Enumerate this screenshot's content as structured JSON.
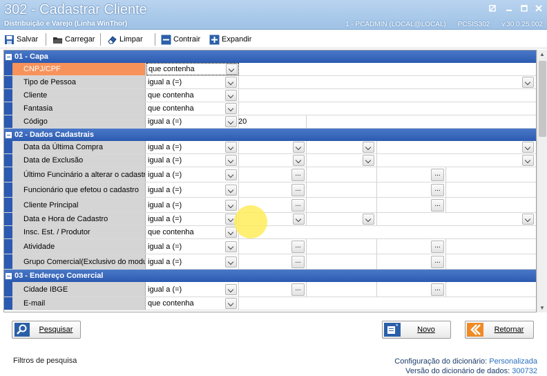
{
  "window": {
    "title": "302 - Cadastrar Cliente",
    "subtitle": "Distribuição e Varejo (Linha WinThor)",
    "connection": "1 - PCADMIN (LOCAL@LOCAL)",
    "program": "PCSIS302",
    "version": "v.30.0.25.002"
  },
  "toolbar": {
    "salvar": "Salvar",
    "carregar": "Carregar",
    "limpar": "Limpar",
    "contrair": "Contrair",
    "expandir": "Expandir"
  },
  "sections": [
    {
      "title": "01 - Capa",
      "rows": [
        {
          "label": "CNPJ/CPF",
          "op": "que contenha",
          "selected": true
        },
        {
          "label": "Tipo de Pessoa",
          "op": "igual a (=)"
        },
        {
          "label": "Cliente",
          "op": "que contenha"
        },
        {
          "label": "Fantasia",
          "op": "que contenha"
        },
        {
          "label": "Código",
          "op": "igual a (=)",
          "value": "20"
        }
      ]
    },
    {
      "title": "02 - Dados Cadastrais",
      "rows": [
        {
          "label": "Data da Última Compra",
          "op": "igual a (=)"
        },
        {
          "label": "Data de Exclusão",
          "op": "igual a (=)"
        },
        {
          "label": "Último Funcinário a alterar o cadastro",
          "op": "igual a (=)"
        },
        {
          "label": "Funcionário que efetou o cadastro",
          "op": "igual a (=)"
        },
        {
          "label": "Cliente Principal",
          "op": "igual a (=)"
        },
        {
          "label": "Data e Hora de Cadastro",
          "op": "igual a (=)"
        },
        {
          "label": "Insc. Est. / Produtor",
          "op": "que contenha"
        },
        {
          "label": "Atividade",
          "op": "igual a (=)"
        },
        {
          "label": "Grupo Comercial(Exclusivo do modulo",
          "op": "igual a (=)"
        }
      ]
    },
    {
      "title": "03 - Endereço Comercial",
      "rows": [
        {
          "label": "Cidade IBGE",
          "op": "igual a (=)"
        },
        {
          "label": "E-mail",
          "op": "que contenha"
        }
      ]
    }
  ],
  "ellipsis": "...",
  "buttons": {
    "pesquisar": "Pesquisar",
    "novo": "Novo",
    "retornar": "Retornar"
  },
  "status": {
    "left": "Filtros de pesquisa",
    "config_label": "Configuração do dicionário:",
    "config_value": "Personalizada",
    "version_label": "Versão do dicionário de dados:",
    "version_value": "300732"
  },
  "colors": {
    "section_blue": "#2c5ab0",
    "selected_label": "#f7925a",
    "label_bg": "#d5d5d5"
  }
}
